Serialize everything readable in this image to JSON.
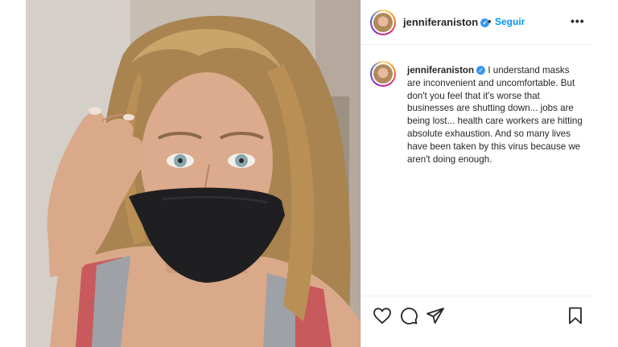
{
  "post": {
    "username": "jenniferaniston",
    "verified_icon": "verified-badge-icon",
    "separator": "•",
    "follow_label": "Seguir",
    "more_label": "•••",
    "caption": "I understand masks are inconvenient and uncomfortable. But don't you feel that it's worse that businesses are shutting down... jobs are being lost... health care workers are hitting absolute exhaustion. And so many lives have been taken by this virus because we aren't doing enough."
  },
  "actions": {
    "icons": [
      "heart-icon",
      "comment-icon",
      "share-icon",
      "bookmark-icon"
    ]
  },
  "colors": {
    "accent": "#0095f6",
    "verified": "#3897f0",
    "text": "#262626",
    "border": "#efefef"
  }
}
